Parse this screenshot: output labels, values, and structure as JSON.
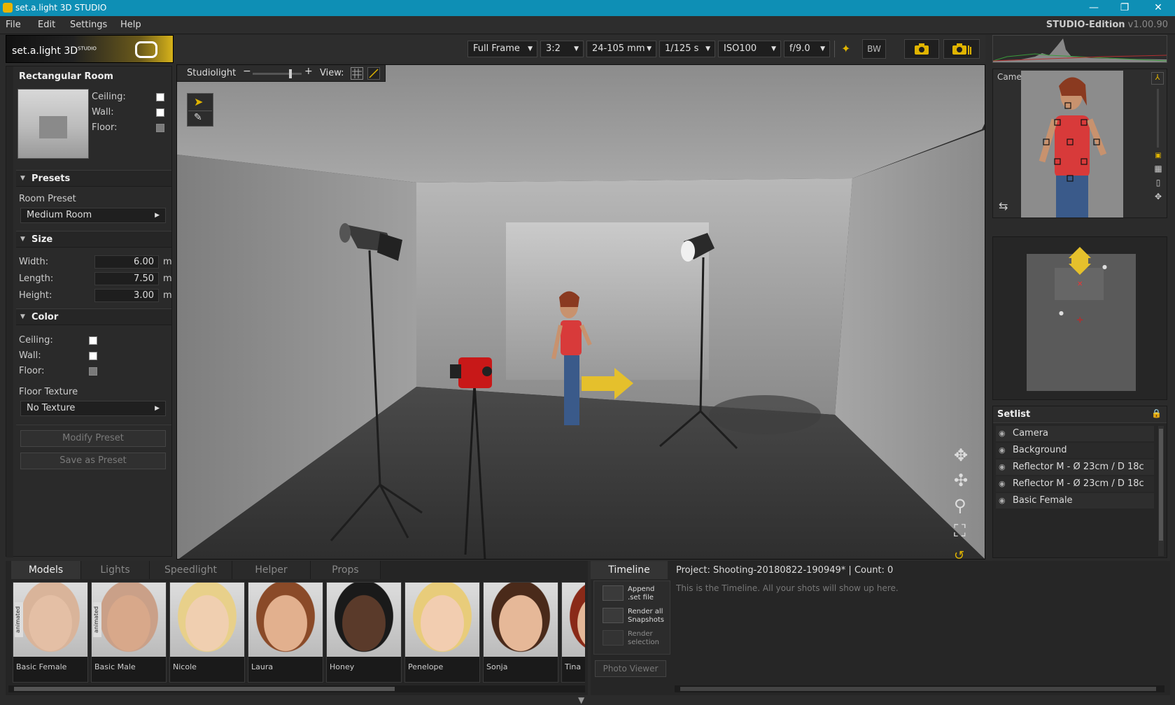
{
  "window": {
    "title": "set.a.light 3D STUDIO"
  },
  "menu": {
    "items": [
      "File",
      "Edit",
      "Settings",
      "Help"
    ],
    "edition": "STUDIO-Edition",
    "version": "v1.00.90"
  },
  "brand": {
    "name": "set.a.light 3D",
    "sup": "STUDIO"
  },
  "toolbar": {
    "sensor": "Full Frame",
    "ratio": "3:2",
    "lens": "24-105 mm",
    "shutter": "1/125 s",
    "iso": "ISO100",
    "aperture": "f/9.0",
    "bw": "BW"
  },
  "room": {
    "title": "Rectangular Room",
    "labels": {
      "ceiling": "Ceiling:",
      "wall": "Wall:",
      "floor": "Floor:"
    },
    "presets_header": "Presets",
    "room_preset_label": "Room Preset",
    "room_preset_value": "Medium Room",
    "size_header": "Size",
    "width_label": "Width:",
    "width": "6.00",
    "length_label": "Length:",
    "length": "7.50",
    "height_label": "Height:",
    "height": "3.00",
    "unit": "m",
    "color_header": "Color",
    "floor_texture_label": "Floor Texture",
    "floor_texture_value": "No Texture",
    "modify_preset": "Modify Preset",
    "save_preset": "Save as Preset",
    "colors": {
      "ceiling": "#ffffff",
      "wall": "#ffffff",
      "floor": "#7a7a7a"
    }
  },
  "viewport": {
    "studiolight_label": "Studiolight",
    "view_label": "View:"
  },
  "camera_preview": {
    "label": "Camera"
  },
  "setlist": {
    "title": "Setlist",
    "items": [
      "Camera",
      "Background",
      "Reflector M - Ø 23cm / D 18c",
      "Reflector M - Ø 23cm / D 18c",
      "Basic Female"
    ]
  },
  "library": {
    "tabs": [
      "Models",
      "Lights",
      "Speedlight",
      "Helper",
      "Props"
    ],
    "animated_label": "animated",
    "models": [
      "Basic Female",
      "Basic Male",
      "Nicole",
      "Laura",
      "Honey",
      "Penelope",
      "Sonja",
      "Tina"
    ]
  },
  "timeline": {
    "tab": "Timeline",
    "project": "Project: Shooting-20180822-190949*",
    "separator": "|",
    "count": "Count: 0",
    "empty_message": "This is the Timeline. All your shots will show up here.",
    "buttons": {
      "append": [
        "Append",
        ".set file"
      ],
      "render_all": [
        "Render all",
        "Snapshots"
      ],
      "render_sel": [
        "Render",
        "selection"
      ]
    },
    "photo_viewer": "Photo Viewer"
  }
}
